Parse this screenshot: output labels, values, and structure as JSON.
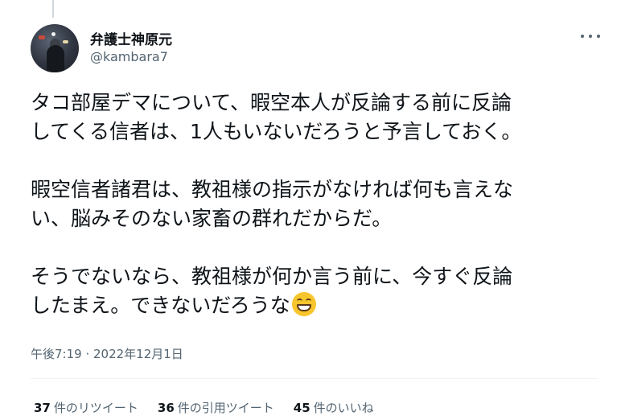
{
  "tweet": {
    "author": {
      "display_name": "弁護士神原元",
      "handle": "@kambara7"
    },
    "paragraphs": [
      "タコ部屋デマについて、暇空本人が反論する前に反論\nしてくる信者は、1人もいないだろうと予言しておく。",
      "暇空信者諸君は、教祖様の指示がなければ何も言えな\nい、脳みそのない家畜の群れだからだ。"
    ],
    "last_paragraph": "そうでないなら、教祖様が何か言う前に、今すぐ反論\nしたまえ。できないだろうな",
    "emoji": "grinning-face-with-smiling-eyes",
    "timestamp": "午後7:19 · 2022年12月1日",
    "stats": [
      {
        "count": "37",
        "label": "件のリツイート"
      },
      {
        "count": "36",
        "label": "件の引用ツイート"
      },
      {
        "count": "45",
        "label": "件のいいね"
      }
    ]
  },
  "icons": {
    "more": "more-horizontal-icon"
  }
}
